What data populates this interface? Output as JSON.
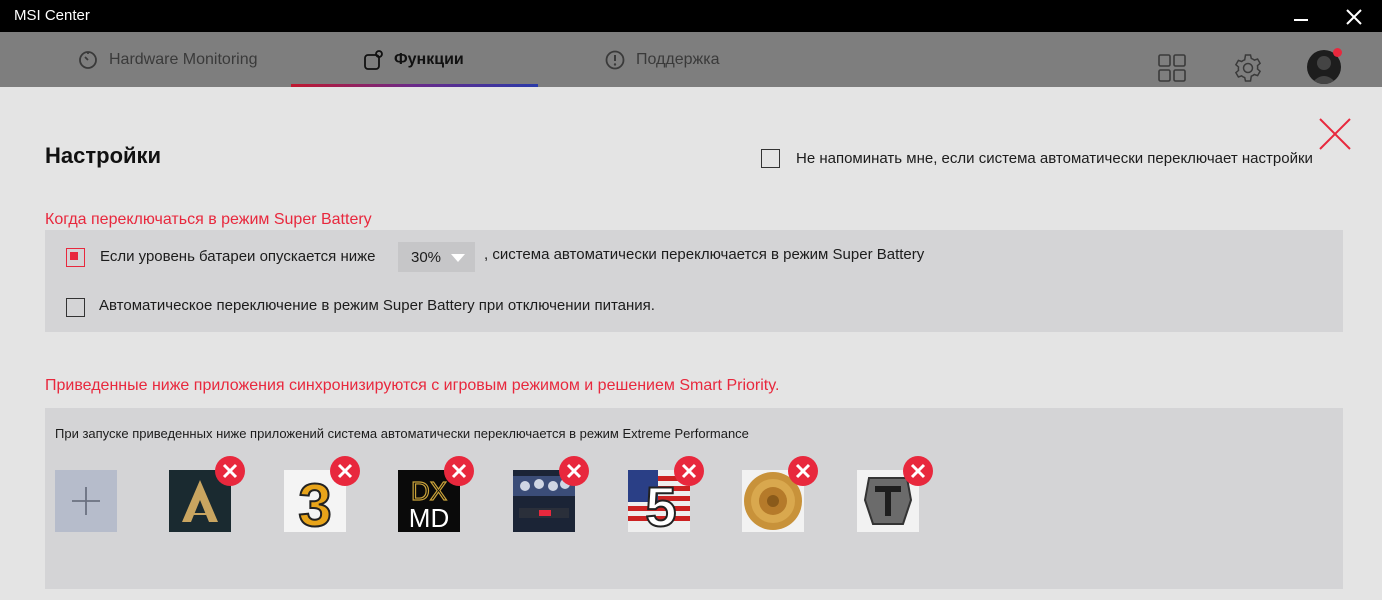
{
  "window": {
    "title": "MSI Center"
  },
  "nav": {
    "tabs": [
      {
        "label": "Hardware Monitoring",
        "icon": "gauge-icon",
        "active": false
      },
      {
        "label": "Функции",
        "icon": "features-icon",
        "active": true
      },
      {
        "label": "Поддержка",
        "icon": "support-icon",
        "active": false
      }
    ],
    "icons": [
      "apps-grid-icon",
      "settings-gear-icon",
      "user-avatar-icon"
    ]
  },
  "settings": {
    "title": "Настройки",
    "dont_remind_label": "Не напоминать мне, если система автоматически переключает настройки",
    "dont_remind_checked": false
  },
  "super_battery": {
    "section_title": "Когда переключаться в режим Super Battery",
    "option1_prefix": "Если уровень батареи опускается ниже",
    "option1_value": "30%",
    "option1_suffix": ", система автоматически переключается в режим Super Battery",
    "option1_checked": true,
    "option2_label": "Автоматическое переключение в режим Super Battery при отключении питания.",
    "option2_checked": false
  },
  "apps": {
    "section_title": "Приведенные ниже приложения синхронизируются с игровым режимом и решением Smart Priority.",
    "description": "При запуске приведенных ниже приложений система автоматически переключается в режим Extreme Performance",
    "items": [
      {
        "icon": "assassins-creed-odyssey-icon"
      },
      {
        "icon": "gta-iii-icon",
        "glyph": "3"
      },
      {
        "icon": "dxmd-icon",
        "text_top": "DX",
        "text_bottom": "MD"
      },
      {
        "icon": "f1-game-icon"
      },
      {
        "icon": "gta-v-icon",
        "glyph": "5"
      },
      {
        "icon": "gold-disc-icon"
      },
      {
        "icon": "world-of-tanks-icon"
      }
    ]
  },
  "colors": {
    "accent": "#e8283d",
    "panel": "#e4e4e4",
    "box": "#d4d4d6",
    "titlebar": "#000000"
  }
}
